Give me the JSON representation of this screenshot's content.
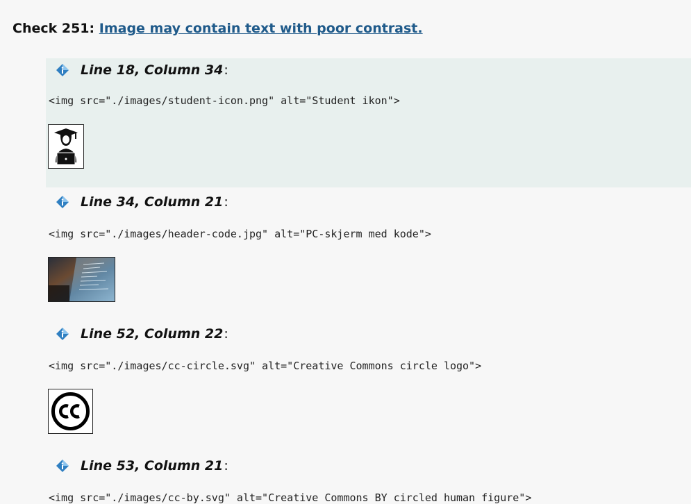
{
  "check": {
    "prefix": "Check 251: ",
    "link_text": "Image may contain text with poor contrast."
  },
  "issues": [
    {
      "location": "Line 18, Column 34",
      "colon": ":",
      "code": "<img src=\"./images/student-icon.png\" alt=\"Student ikon\">",
      "image": "student-icon"
    },
    {
      "location": "Line 34, Column 21",
      "colon": ":",
      "code": "<img src=\"./images/header-code.jpg\" alt=\"PC-skjerm med kode\">",
      "image": "header-code"
    },
    {
      "location": "Line 52, Column 22",
      "colon": ":",
      "code": "<img src=\"./images/cc-circle.svg\" alt=\"Creative Commons circle logo\">",
      "image": "cc-circle"
    },
    {
      "location": "Line 53, Column 21",
      "colon": ":",
      "code": "<img src=\"./images/cc-by.svg\" alt=\"Creative Commons BY circled human figure\">",
      "image": "cc-by"
    }
  ],
  "colors": {
    "link": "#1f5a8a",
    "highlight": "#e8f0ee",
    "icon": "#2f7fc1"
  },
  "icons": {
    "issue_marker": "blue-diamond-info-icon"
  }
}
